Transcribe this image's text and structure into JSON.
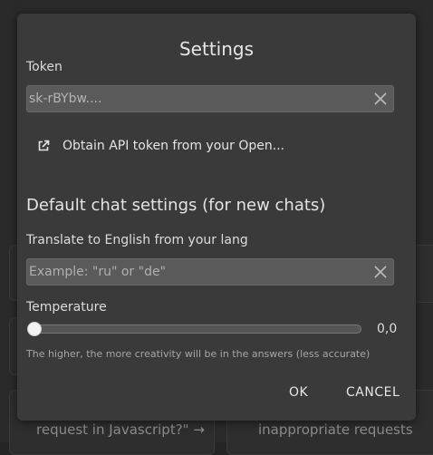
{
  "dialog": {
    "title": "Settings",
    "token": {
      "label": "Token",
      "value": "sk-rBYbw...."
    },
    "obtain_link": {
      "label": "Obtain API token from your Open...",
      "icon": "external-link-icon"
    },
    "section_title": "Default chat settings (for new chats)",
    "translate": {
      "label": "Translate to English from your lang",
      "placeholder": "Example: \"ru\" or \"de\"",
      "value": ""
    },
    "temperature": {
      "label": "Temperature",
      "value_text": "0,0",
      "value": 0.0,
      "hint": "The higher, the more creativity will be in the answers (less accurate)"
    },
    "buttons": {
      "ok": "OK",
      "cancel": "CANCEL"
    }
  },
  "background": {
    "visible_texts": [
      "request in Javascript?\" →",
      "inappropriate requests"
    ]
  },
  "colors": {
    "dialog_bg": "#3a3a3a",
    "field_bg": "#5a5a5a",
    "backdrop": "#2a2a2a",
    "text": "#e6e6e6"
  }
}
